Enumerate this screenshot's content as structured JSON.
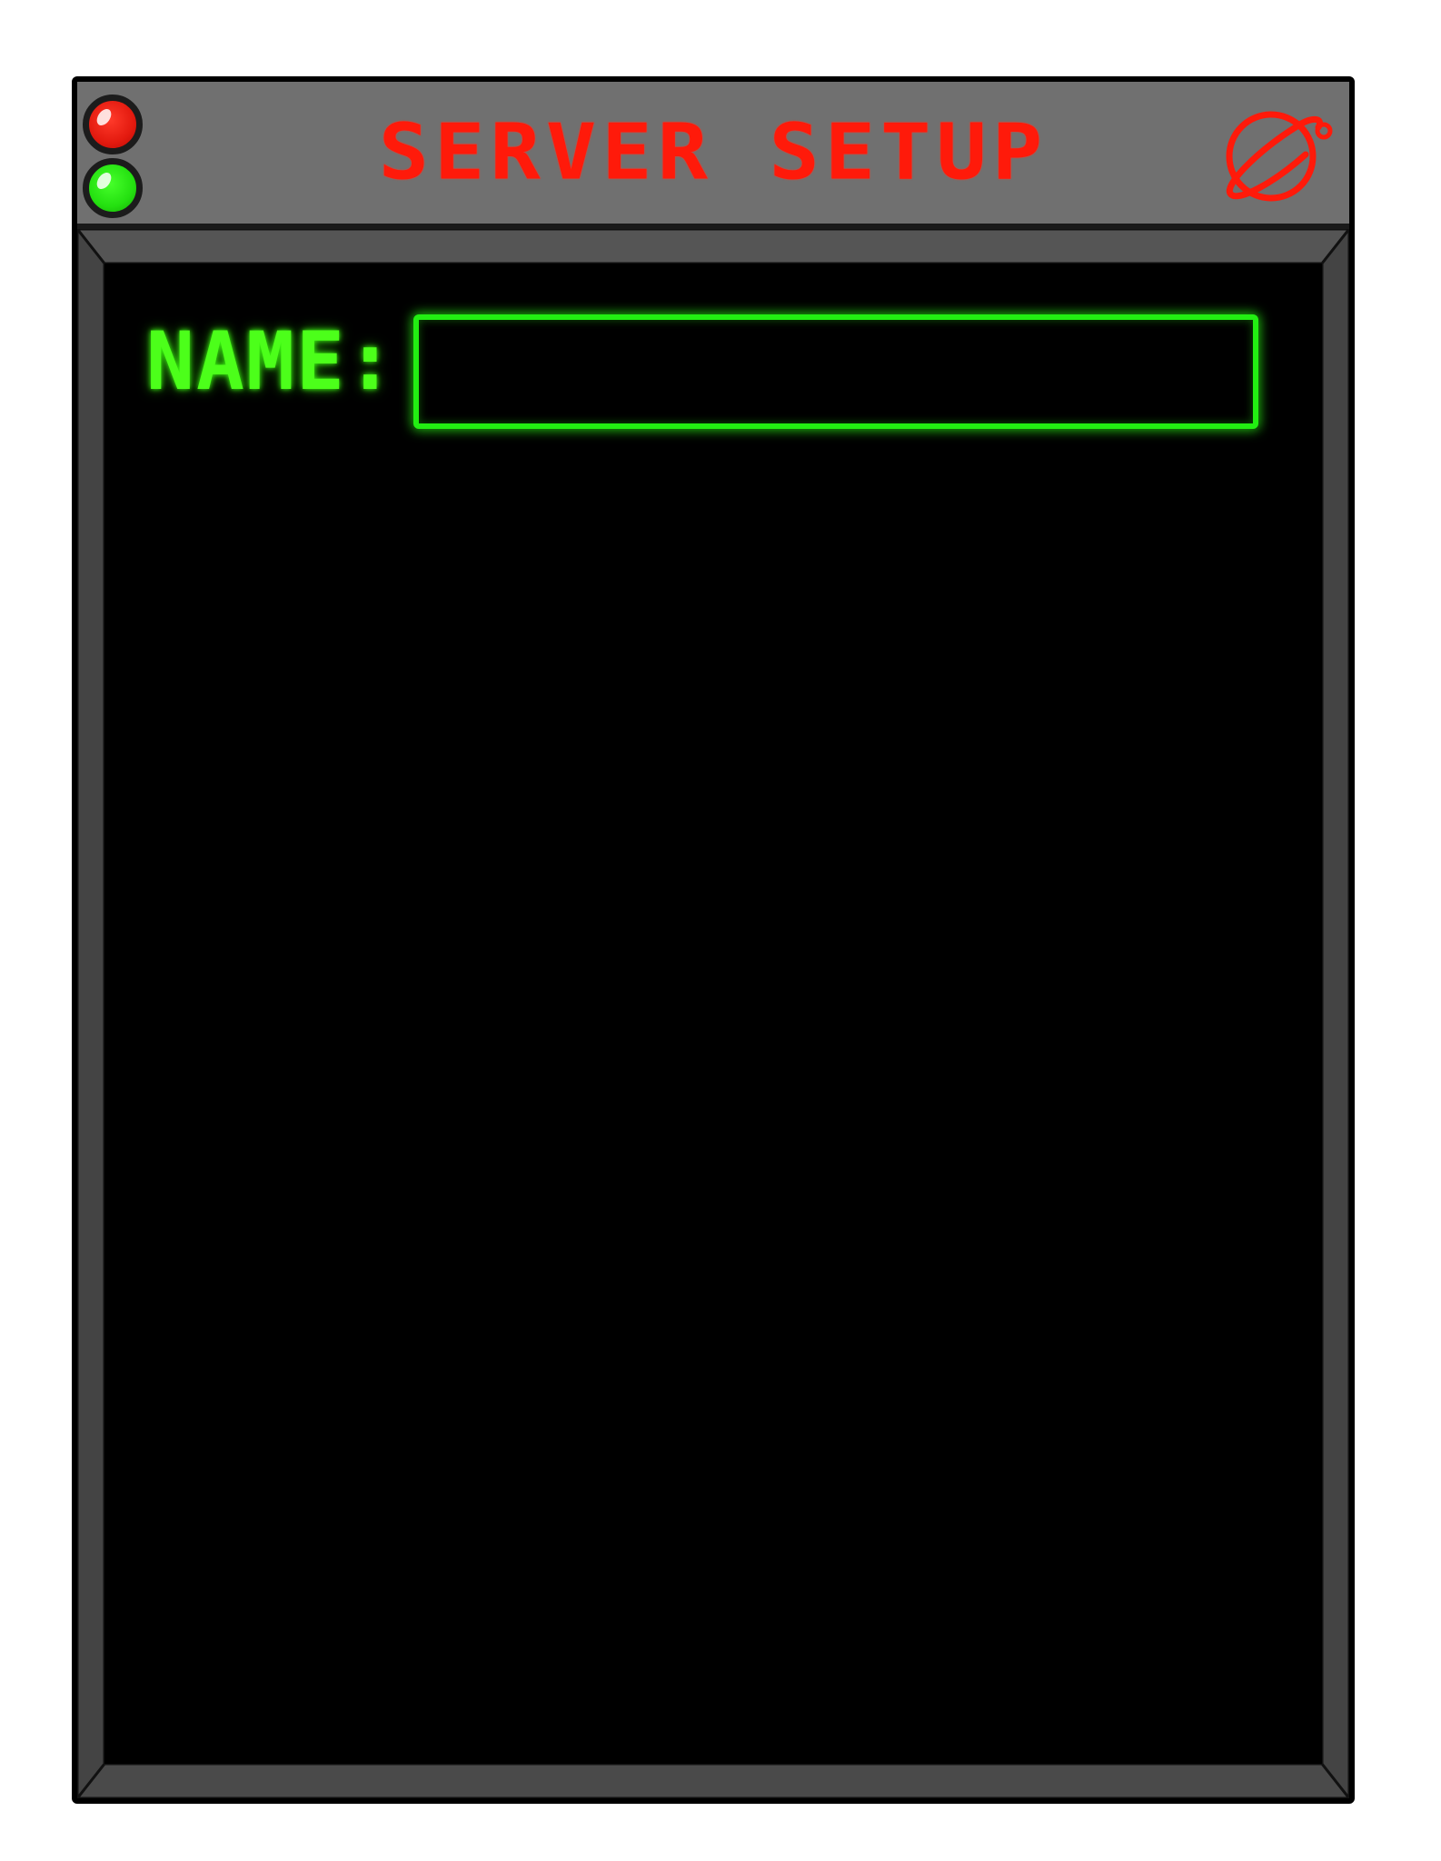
{
  "window": {
    "title": "SERVER SETUP",
    "indicators": [
      {
        "name": "red-led",
        "color": "#e31a0f"
      },
      {
        "name": "green-led",
        "color": "#24e010"
      }
    ],
    "title_color": "#ff1a0a",
    "corner_icon": "planet-icon"
  },
  "form": {
    "name_label": "NAME:",
    "name_value": "",
    "accent_color": "#22ee12"
  }
}
